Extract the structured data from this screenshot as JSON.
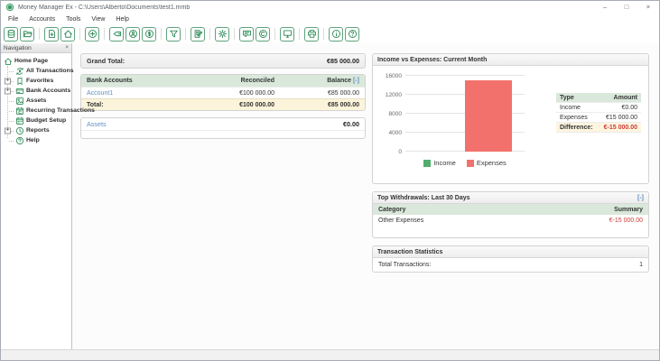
{
  "window": {
    "title": "Money Manager Ex - C:\\Users\\Alberto\\Documents\\test1.mmb",
    "controls": {
      "minimize": "–",
      "maximize": "□",
      "close": "×"
    }
  },
  "menu": {
    "items": [
      "File",
      "Accounts",
      "Tools",
      "View",
      "Help"
    ]
  },
  "toolbar": {
    "groups": [
      [
        "new-database-icon",
        "open-database-icon"
      ],
      [
        "new-file-icon",
        "home-page-icon"
      ],
      [
        "new-transaction-icon"
      ],
      [
        "categories-icon",
        "payees-icon",
        "currencies-icon"
      ],
      [
        "filter-icon"
      ],
      [
        "grm-icon"
      ],
      [
        "options-icon"
      ],
      [
        "news-icon",
        "currency-rates-icon"
      ],
      [
        "reports-icon"
      ],
      [
        "print-icon"
      ],
      [
        "about-icon",
        "help-icon"
      ]
    ]
  },
  "navigation": {
    "header": "Navigation",
    "close_glyph": "×",
    "items": [
      {
        "label": "Home Page",
        "icon": "nav-home-icon",
        "expandable": false
      },
      {
        "label": "All Transactions",
        "icon": "all-transactions-icon",
        "expandable": false
      },
      {
        "label": "Favorites",
        "icon": "favorites-icon",
        "expandable": true
      },
      {
        "label": "Bank Accounts",
        "icon": "bank-accounts-icon",
        "expandable": true
      },
      {
        "label": "Assets",
        "icon": "assets-icon",
        "expandable": false
      },
      {
        "label": "Recurring Transactions",
        "icon": "recurring-transactions-icon",
        "expandable": false
      },
      {
        "label": "Budget Setup",
        "icon": "budget-setup-icon",
        "expandable": false
      },
      {
        "label": "Reports",
        "icon": "nav-reports-icon",
        "expandable": true
      },
      {
        "label": "Help",
        "icon": "nav-help-icon",
        "expandable": false
      }
    ]
  },
  "main": {
    "grand_total": {
      "label": "Grand Total:",
      "value": "€85 000.00"
    },
    "bank_accounts": {
      "headers": [
        "Bank Accounts",
        "Reconciled",
        "Balance"
      ],
      "collapse_link": "[-]",
      "rows": [
        {
          "name": "Account1",
          "reconciled": "€100 000.00",
          "balance": "€85 000.00"
        }
      ],
      "total": {
        "label": "Total:",
        "reconciled": "€100 000.00",
        "balance": "€85 000.00"
      }
    },
    "assets": {
      "label": "Assets",
      "value": "€0.00"
    },
    "income_vs_expenses": {
      "title": "Income vs Expenses: Current Month",
      "table": {
        "headers": [
          "Type",
          "Amount"
        ],
        "rows": [
          {
            "type": "Income",
            "amount": "€0.00"
          },
          {
            "type": "Expenses",
            "amount": "€15 000.00"
          }
        ],
        "difference": {
          "label": "Difference:",
          "value": "€-15 000.00"
        }
      }
    },
    "top_withdrawals": {
      "title": "Top Withdrawals: Last 30 Days",
      "collapse_link": "[-]",
      "headers": [
        "Category",
        "Summary"
      ],
      "rows": [
        {
          "category": "Other Expenses",
          "summary": "€-15 000.00"
        }
      ]
    },
    "transaction_statistics": {
      "title": "Transaction Statistics",
      "rows": [
        {
          "label": "Total Transactions:",
          "value": "1"
        }
      ]
    }
  },
  "chart_data": {
    "type": "bar",
    "title": "Income vs Expenses: Current Month",
    "categories": [
      "Income",
      "Expenses"
    ],
    "values": [
      0,
      15000
    ],
    "colors": [
      "#52ad6e",
      "#f3716c"
    ],
    "ylim": [
      0,
      16000
    ],
    "yticks": [
      0,
      4000,
      8000,
      12000,
      16000
    ],
    "legend": [
      "Income",
      "Expenses"
    ],
    "legend_position": "bottom",
    "grid": true
  },
  "colors": {
    "accent_green": "#2e8b57",
    "table_header": "#d9e8da",
    "total_row": "#fbf4da",
    "difference_row": "#fdf5df",
    "negative": "#cf3b36",
    "link": "#5f8fc4",
    "bar_expenses": "#f3716c",
    "bar_income": "#52ad6e"
  }
}
